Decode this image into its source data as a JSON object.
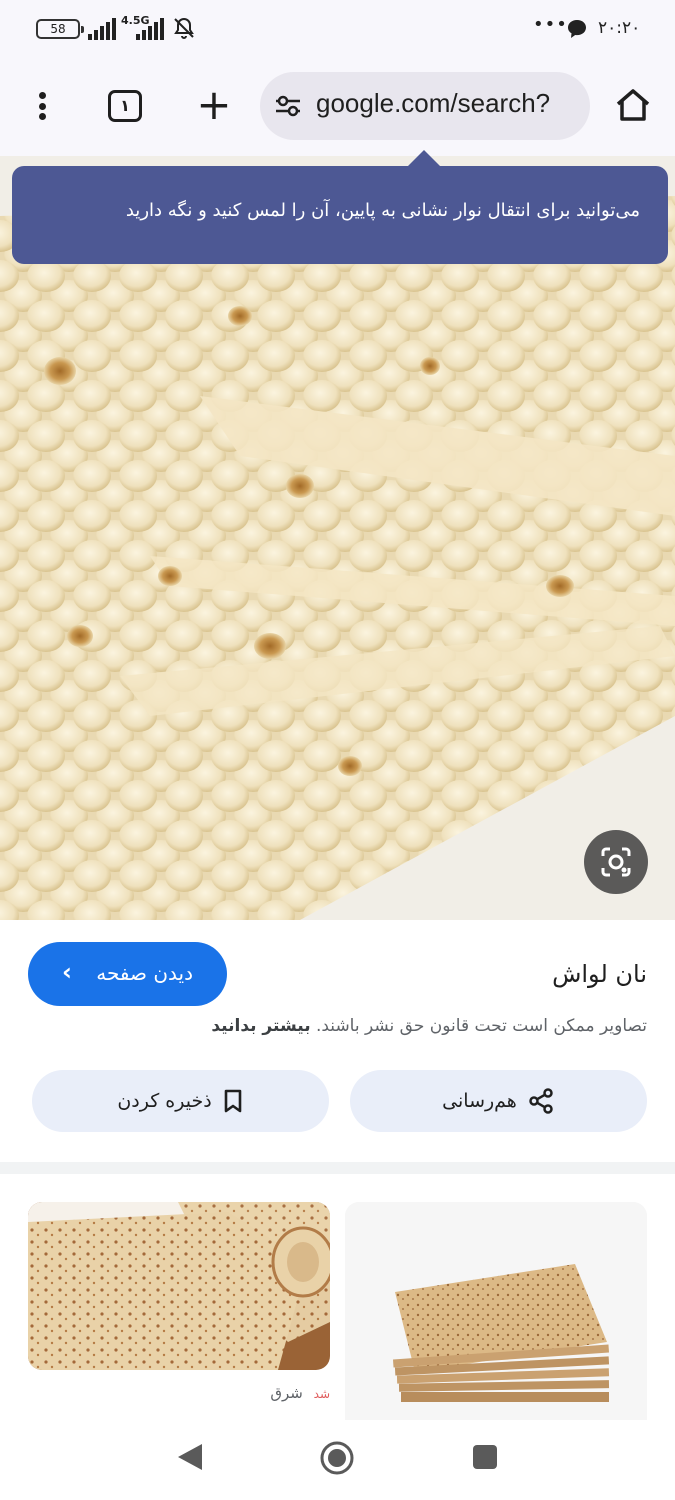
{
  "status_bar": {
    "battery": "58",
    "network": "4.5G",
    "time": "۲۰:۲۰",
    "more": "•••"
  },
  "toolbar": {
    "tab_count": "۱",
    "new_tab": "+",
    "url": "google.com/search?"
  },
  "tooltip": {
    "text": "می‌توانید برای انتقال نوار نشانی به پایین، آن را لمس کنید و نگه دارید"
  },
  "details": {
    "title": "نان لواش",
    "visit_label": "دیدن صفحه",
    "visit_chevron": "‹",
    "copyright_text": "تصاویر ممکن است تحت قانون حق نشر باشند.",
    "learn_more": "بیشتر بدانید",
    "share_label": "هم‌رسانی",
    "save_label": "ذخیره کردن"
  },
  "related": {
    "source_name": "شرق",
    "source_logo": "شد"
  },
  "colors": {
    "tooltip_bg": "#4d5894",
    "primary_button": "#1a73e8",
    "pill_bg": "#e9eef9",
    "chrome_bg": "#f8f7fc"
  }
}
